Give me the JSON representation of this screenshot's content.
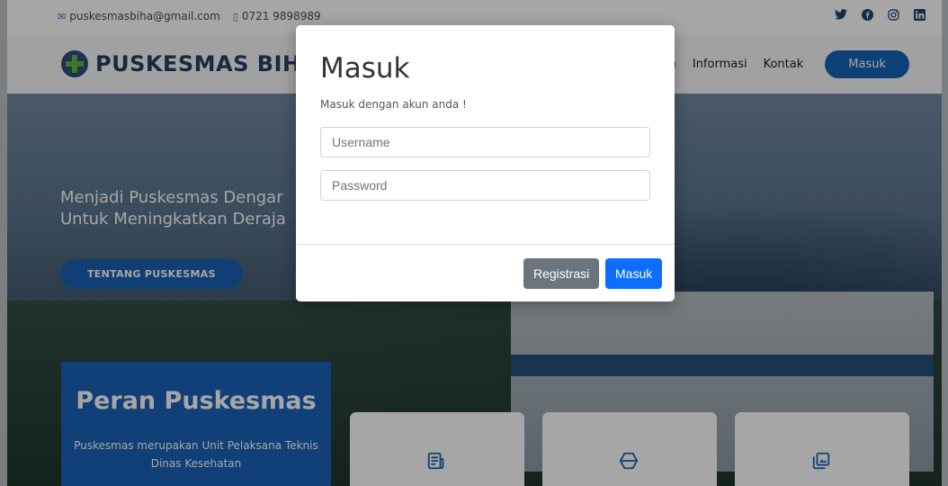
{
  "topbar": {
    "email": "puskesmasbiha@gmail.com",
    "phone": "0721 9898989",
    "email_icon": "envelope-icon",
    "phone_icon": "phone-icon",
    "socials": [
      "twitter-icon",
      "facebook-icon",
      "instagram-icon",
      "linkedin-icon"
    ]
  },
  "header": {
    "logo_text": "PUSKESMAS BIHA",
    "nav": {
      "layanan": "anan",
      "informasi": "Informasi",
      "kontak": "Kontak",
      "masuk": "Masuk"
    }
  },
  "hero": {
    "line1": "Menjadi Puskesmas Dengar",
    "line2": "Untuk Meningkatkan Deraja",
    "button": "TENTANG PUSKESMAS"
  },
  "peran": {
    "title": "Peran Puskesmas",
    "text": "Puskesmas merupakan Unit Pelaksana Teknis Dinas Kesehatan"
  },
  "modal": {
    "title": "Masuk",
    "subtitle": "Masuk dengan akun anda !",
    "username_placeholder": "Username",
    "password_placeholder": "Password",
    "register_label": "Registrasi",
    "login_label": "Masuk"
  },
  "colors": {
    "primary": "#0d6efd",
    "secondary": "#6c757d",
    "brand": "#1a63b7"
  }
}
